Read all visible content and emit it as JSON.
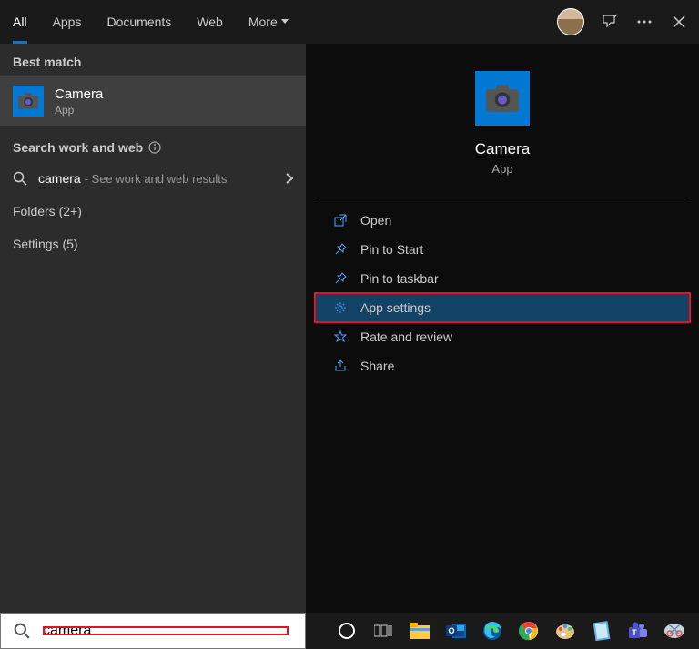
{
  "tabs": [
    "All",
    "Apps",
    "Documents",
    "Web",
    "More"
  ],
  "best_match_header": "Best match",
  "best_match": {
    "title": "Camera",
    "subtitle": "App"
  },
  "search_section_header": "Search work and web",
  "search_row": {
    "query": "camera",
    "hint": "- See work and web results"
  },
  "folders_section": "Folders (2+)",
  "settings_section": "Settings (5)",
  "preview": {
    "title": "Camera",
    "subtitle": "App"
  },
  "actions": [
    "Open",
    "Pin to Start",
    "Pin to taskbar",
    "App settings",
    "Rate and review",
    "Share"
  ],
  "selected_action_index": 3,
  "search_value": "camera"
}
